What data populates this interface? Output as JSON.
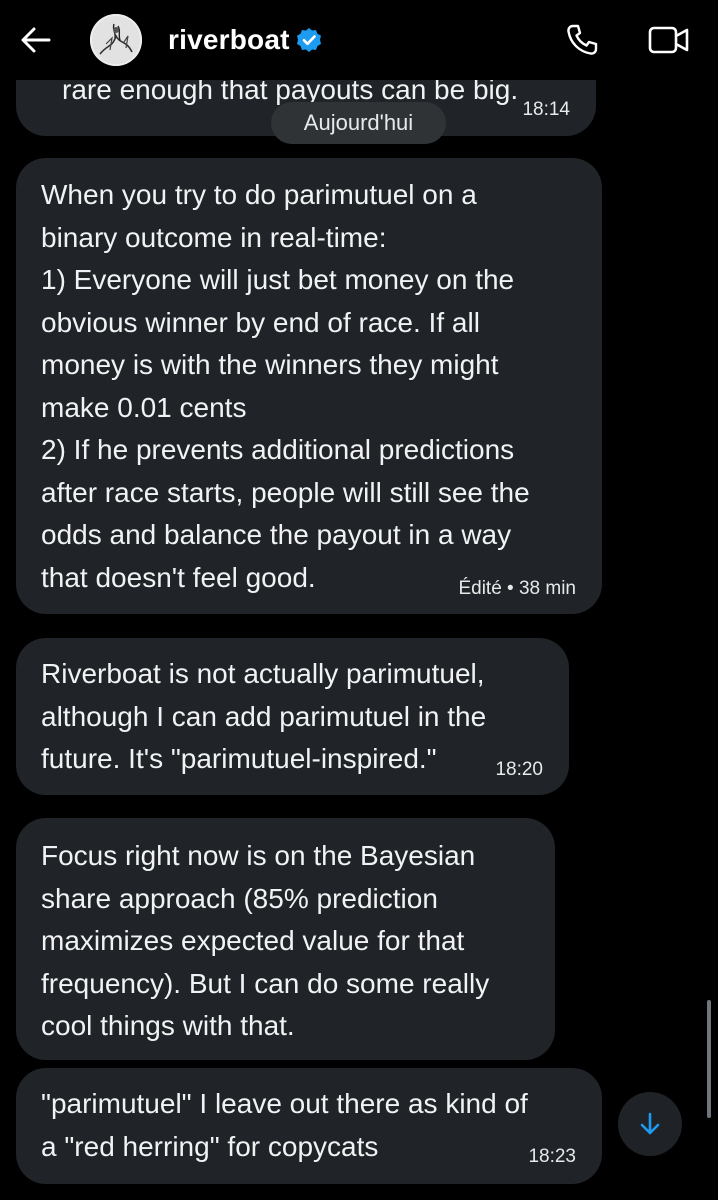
{
  "header": {
    "contact_name": "riverboat",
    "back_icon": "arrow-left-icon",
    "verified_icon": "verified-badge-icon",
    "call_icon": "phone-icon",
    "video_icon": "video-camera-icon",
    "verified_color": "#1d9bf0"
  },
  "date_separator": "Aujourd'hui",
  "messages": [
    {
      "text": "rare enough that payouts can be big.",
      "time": "18:14"
    },
    {
      "text": "When you try to do parimutuel on a\nbinary outcome in real-time:\n1) Everyone will just bet money on the\nobvious winner by end of race. If all\nmoney is with the winners they might\nmake 0.01 cents\n2) If he prevents additional predictions\nafter race starts, people will still see the\nodds and balance the payout in a way\nthat doesn't feel good.",
      "time": "Édité • 38 min"
    },
    {
      "text": "Riverboat is not actually parimutuel,\nalthough I can add parimutuel in the\nfuture. It's \"parimutuel-inspired.\"",
      "time": "18:20"
    },
    {
      "text": "Focus right now is on the Bayesian\nshare approach (85% prediction\nmaximizes expected value for that\nfrequency). But I can do some really\ncool things with that.",
      "time": ""
    },
    {
      "text": "\"parimutuel\" I leave out there as kind of\na \"red herring\" for copycats",
      "time": "18:23"
    }
  ],
  "scroll_down_icon": "arrow-down-icon",
  "colors": {
    "background": "#000000",
    "bubble": "#202327",
    "accent": "#1d9bf0"
  }
}
